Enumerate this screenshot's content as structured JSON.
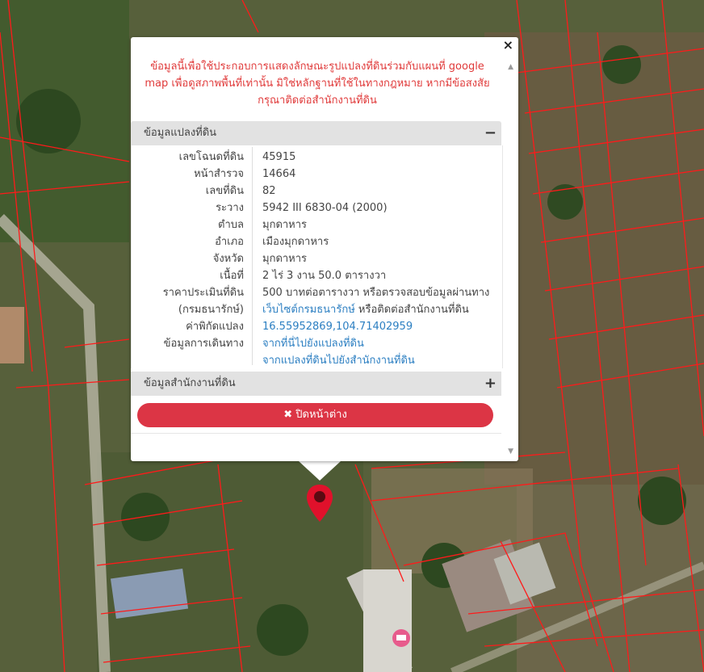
{
  "popup": {
    "close_symbol": "×",
    "warning_text": "ข้อมูลนี้เพื่อใช้ประกอบการแสดงลักษณะรูปแปลงที่ดินร่วมกับแผนที่ google map เพื่อดูสภาพพื้นที่เท่านั้น มิใช่หลักฐานที่ใช้ในทางกฎหมาย หากมีข้อสงสัย กรุณาติดต่อสำนักงานที่ดิน",
    "parcel_section": {
      "title": "ข้อมูลแปลงที่ดิน",
      "toggle": "−",
      "rows": [
        {
          "label": "เลขโฉนดที่ดิน",
          "value": "45915"
        },
        {
          "label": "หน้าสำรวจ",
          "value": "14664"
        },
        {
          "label": "เลขที่ดิน",
          "value": "82"
        },
        {
          "label": "ระวาง",
          "value": "5942 III 6830-04 (2000)"
        },
        {
          "label": "ตำบล",
          "value": "มุกดาหาร"
        },
        {
          "label": "อำเภอ",
          "value": "เมืองมุกดาหาร"
        },
        {
          "label": "จังหวัด",
          "value": "มุกดาหาร"
        },
        {
          "label": "เนื้อที่",
          "value": "2 ไร่ 3 งาน 50.0 ตารางวา"
        },
        {
          "label": "ราคาประเมินที่ดิน",
          "value": "500 บาทต่อตารางวา หรือตรวจสอบข้อมูลผ่านทาง"
        },
        {
          "label": "(กรมธนารักษ์)",
          "value_link": "เว็บไซต์กรมธนารักษ์",
          "value_suffix": " หรือติดต่อสำนักงานที่ดิน"
        },
        {
          "label": "ค่าพิกัดแปลง",
          "value_link": "16.55952869,104.71402959"
        },
        {
          "label": "ข้อมูลการเดินทาง",
          "value_link": "จากที่นี่ไปยังแปลงที่ดิน"
        },
        {
          "label": "",
          "value_link": "จากแปลงที่ดินไปยังสำนักงานที่ดิน"
        }
      ]
    },
    "office_section": {
      "title": "ข้อมูลสำนักงานที่ดิน",
      "toggle": "+"
    },
    "close_button_icon": "✖",
    "close_button_label": "ปิดหน้าต่าง"
  },
  "colors": {
    "warning": "#e03a3a",
    "button": "#dc3545",
    "link": "#2c7fc2",
    "parcel_line": "#ff1a1a",
    "marker": "#e0112b"
  }
}
